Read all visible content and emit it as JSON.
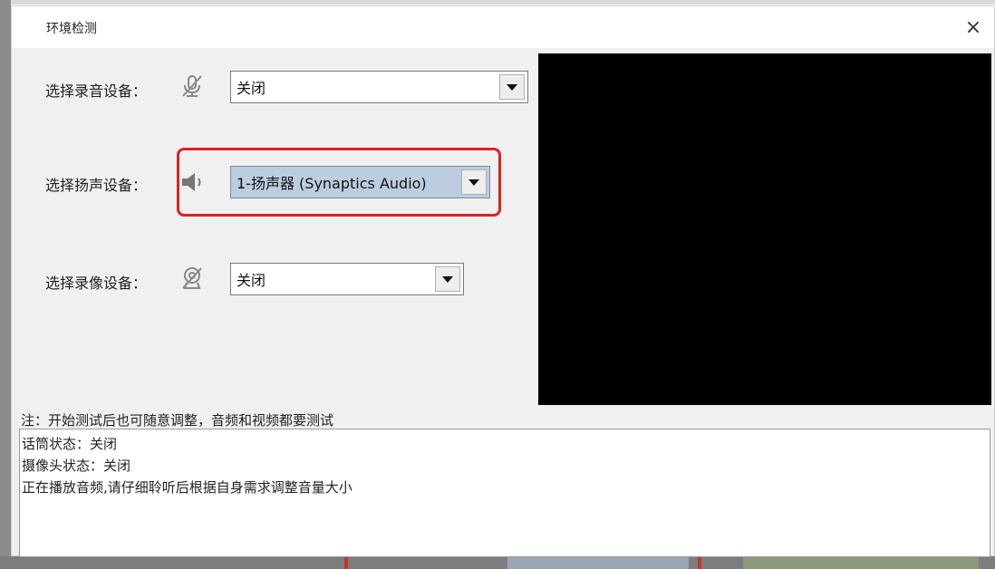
{
  "window": {
    "title": "环境检测",
    "close_label": "×"
  },
  "rows": [
    {
      "label": "选择录音设备：",
      "icon": "microphone-muted-icon",
      "value": "关闭"
    },
    {
      "label": "选择扬声设备：",
      "icon": "speaker-icon",
      "value": "1-扬声器 (Synaptics Audio)"
    },
    {
      "label": "选择录像设备：",
      "icon": "camera-muted-icon",
      "value": "关闭"
    }
  ],
  "note": "注：开始测试后也可随意调整，音频和视频都要测试",
  "log": [
    "话筒状态：关闭",
    "摄像头状态：关闭",
    "正在播放音频,请仔细聆听后根据自身需求调整音量大小"
  ],
  "colors": {
    "highlight": "#e02020",
    "selected_bg": "#bccde0",
    "preview_bg": "#000000"
  }
}
